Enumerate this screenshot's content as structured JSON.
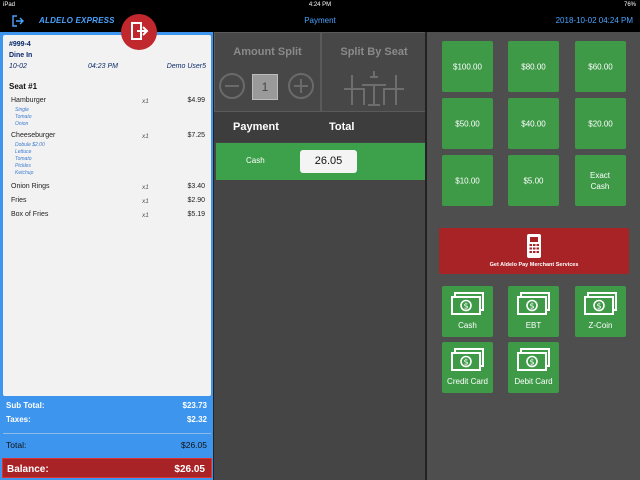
{
  "status_bar": {
    "device": "iPad",
    "time": "4:24 PM",
    "battery": "76%"
  },
  "header": {
    "brand": "ALDELO EXPRESS",
    "title": "Payment",
    "datetime": "2018-10-02 04:24 PM"
  },
  "order": {
    "number": "#999-4",
    "type": "Dine In",
    "date": "10-02",
    "time": "04:23 PM",
    "employee": "Demo User5",
    "seat_label": "Seat #1",
    "items": [
      {
        "name": "Hamburger",
        "qty": "x1",
        "price": "$4.99",
        "modifiers": [
          "Single",
          "Tomato",
          "Onion"
        ]
      },
      {
        "name": "Cheeseburger",
        "qty": "x1",
        "price": "$7.25",
        "modifiers": [
          "Dobule $2.00",
          "Lettuce",
          "Tomato",
          "Pickles",
          "Ketchup"
        ]
      },
      {
        "name": "Onion Rings",
        "qty": "x1",
        "price": "$3.40",
        "modifiers": []
      },
      {
        "name": "Fries",
        "qty": "x1",
        "price": "$2.90",
        "modifiers": []
      },
      {
        "name": "Box of Fries",
        "qty": "x1",
        "price": "$5.19",
        "modifiers": []
      }
    ],
    "totals": {
      "subtotal_label": "Sub Total:",
      "subtotal": "$23.73",
      "taxes_label": "Taxes:",
      "taxes": "$2.32",
      "total_label": "Total:",
      "total": "$26.05",
      "balance_label": "Balance:",
      "balance": "$26.05"
    }
  },
  "split": {
    "amount_split_label": "Amount Split",
    "split_count": "1",
    "split_by_seat_label": "Split By Seat"
  },
  "payments": {
    "col_payment": "Payment",
    "col_total": "Total",
    "rows": [
      {
        "method": "Cash",
        "amount": "26.05"
      }
    ]
  },
  "quick_cash": [
    "$100.00",
    "$80.00",
    "$60.00",
    "$50.00",
    "$40.00",
    "$20.00",
    "$10.00",
    "$5.00",
    "Exact Cash"
  ],
  "merchant": {
    "label": "Get Aldelo Pay Merchant Services"
  },
  "tenders": [
    "Cash",
    "EBT",
    "Z-Coin",
    "Credit Card",
    "Debit Card"
  ],
  "colors": {
    "accent_blue": "#3d95ee",
    "green": "#3f9a48",
    "red": "#a82326"
  }
}
